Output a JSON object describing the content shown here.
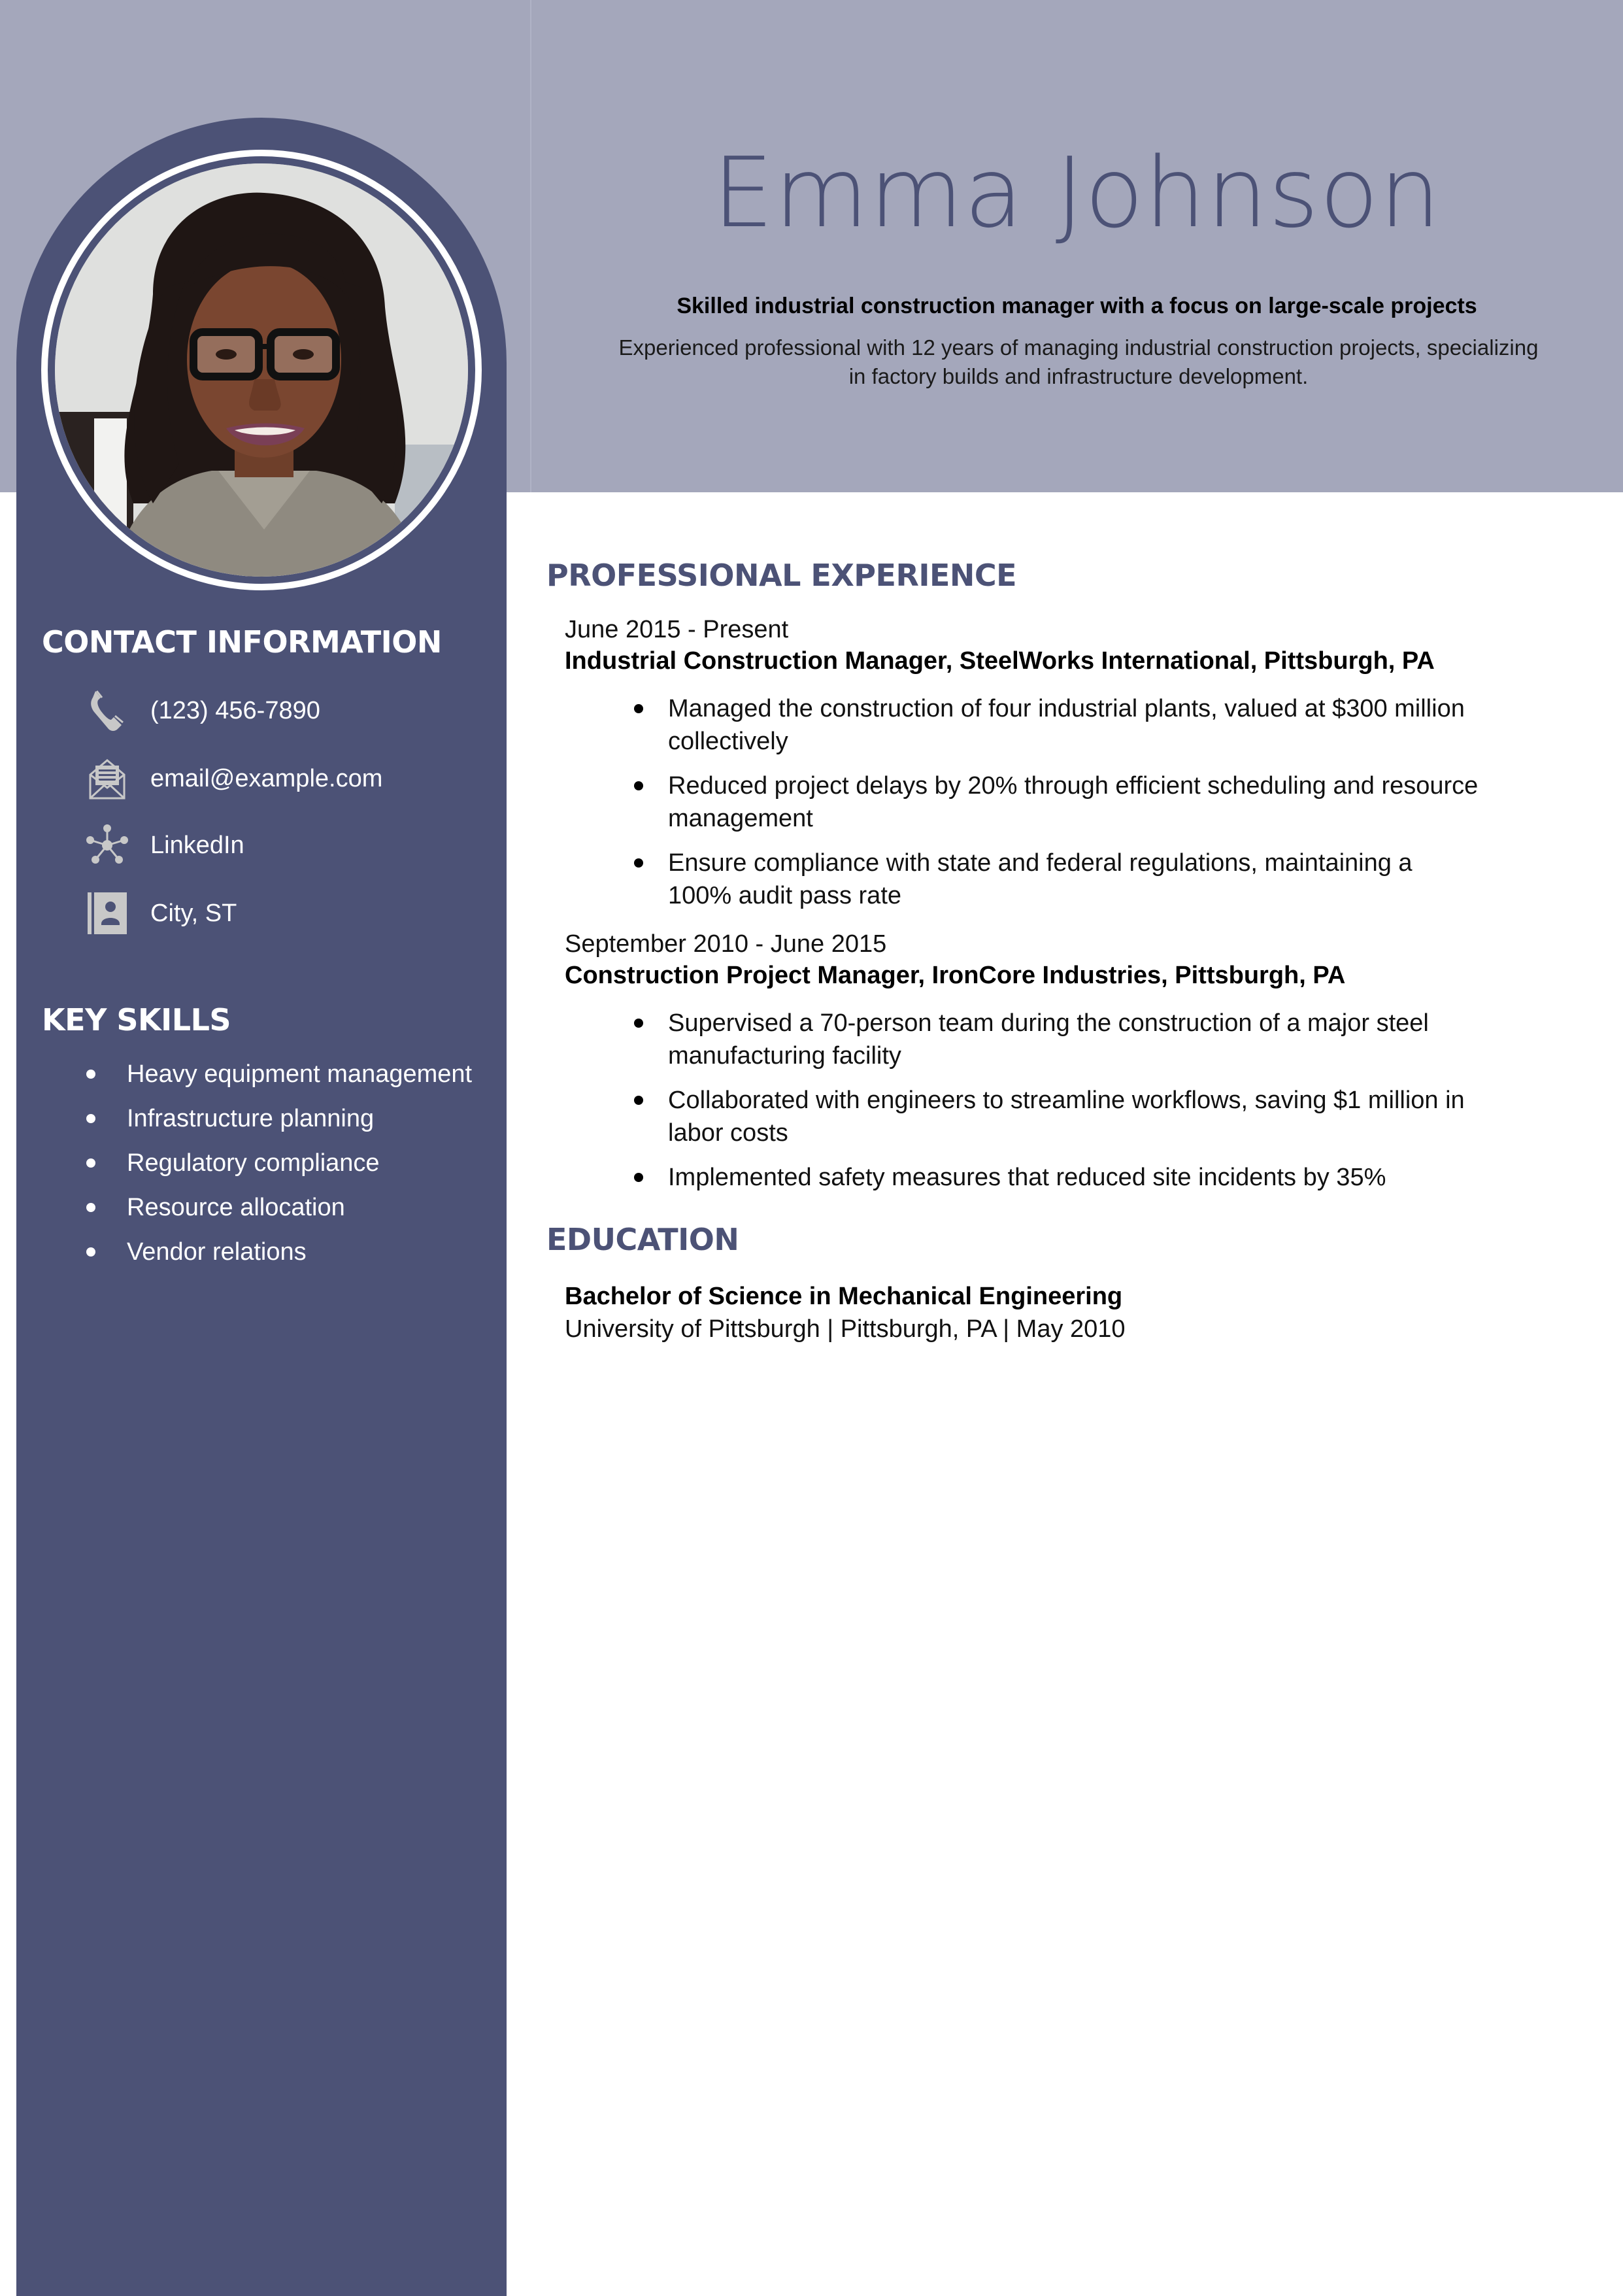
{
  "colors": {
    "accent": "#4c5276",
    "header_bg": "#a4a7bb",
    "icon": "#c8c8c8",
    "page_bg": "#ffffff"
  },
  "header": {
    "name": "Emma Johnson",
    "tagline": "Skilled industrial construction manager with a focus on large-scale projects",
    "summary": "Experienced professional with 12 years of managing industrial construction projects, specializing in factory builds and infrastructure development."
  },
  "profile_photo": {
    "icon": "profile-photo",
    "description": "Portrait of a smiling woman with glasses and long dark curly hair"
  },
  "sidebar": {
    "contact": {
      "heading": "CONTACT INFORMATION",
      "items": [
        {
          "icon": "phone-icon",
          "text": "(123) 456-7890"
        },
        {
          "icon": "envelope-icon",
          "text": "email@example.com"
        },
        {
          "icon": "network-icon",
          "text": "LinkedIn"
        },
        {
          "icon": "contact-card-icon",
          "text": "City, ST"
        }
      ]
    },
    "skills": {
      "heading": "KEY SKILLS",
      "items": [
        "Heavy equipment management",
        "Infrastructure planning",
        "Regulatory compliance",
        "Resource allocation",
        "Vendor relations"
      ]
    }
  },
  "experience": {
    "heading": "PROFESSIONAL EXPERIENCE",
    "jobs": [
      {
        "dates": "June 2015 - Present",
        "title": "Industrial Construction Manager, SteelWorks International, Pittsburgh, PA",
        "bullets": [
          "Managed the construction of four industrial plants, valued at $300 million collectively",
          "Reduced project delays by 20% through efficient scheduling and resource management",
          "Ensure compliance with state and federal regulations, maintaining a 100% audit pass rate"
        ]
      },
      {
        "dates": "September 2010 - June 2015",
        "title": "Construction Project Manager, IronCore Industries, Pittsburgh, PA",
        "bullets": [
          "Supervised a 70-person team during the construction of a major steel manufacturing facility",
          "Collaborated with engineers to streamline workflows, saving $1 million in labor costs",
          "Implemented safety measures that reduced site incidents by 35%"
        ]
      }
    ]
  },
  "education": {
    "heading": "EDUCATION",
    "degree": "Bachelor of Science in Mechanical Engineering",
    "detail": "University of Pittsburgh | Pittsburgh, PA | May 2010"
  }
}
